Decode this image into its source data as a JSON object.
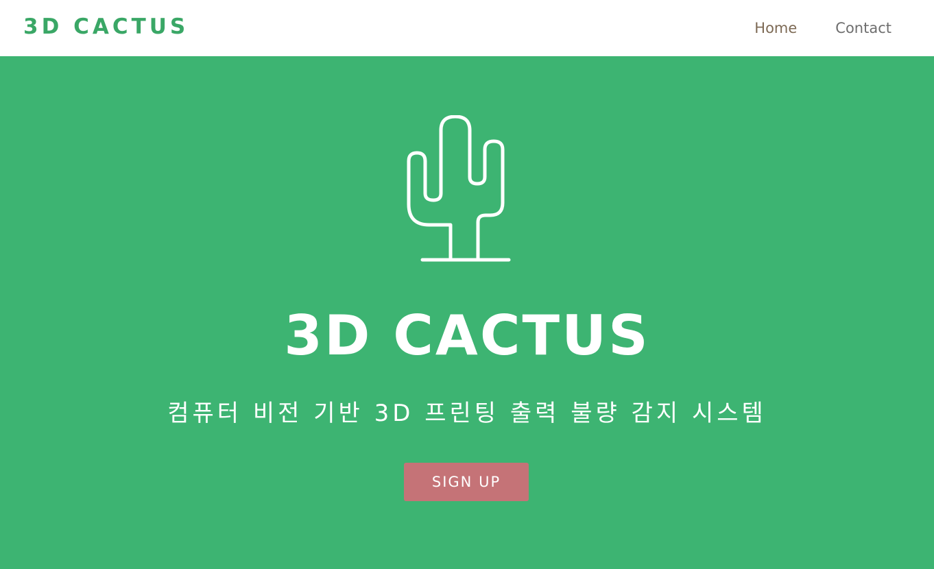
{
  "navbar": {
    "brand": "3D CACTUS",
    "links": [
      {
        "label": "Home"
      },
      {
        "label": "Contact"
      }
    ]
  },
  "hero": {
    "icon": "cactus-icon",
    "title": "3D CACTUS",
    "subtitle": "컴퓨터 비전 기반 3D 프린팅 출력 불량 감지 시스템",
    "cta_label": "SIGN UP"
  },
  "colors": {
    "brand_green": "#3aa766",
    "hero_background": "#3db472",
    "cta_background": "#c57377",
    "nav_text": "#6e6e6e"
  }
}
